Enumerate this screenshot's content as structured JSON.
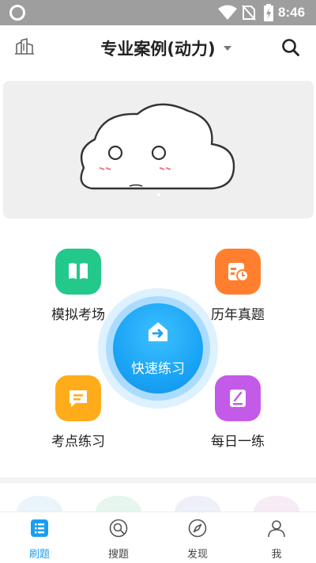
{
  "status_bar": {
    "time": "8:46"
  },
  "header": {
    "title": "专业案例(动力)"
  },
  "grid": {
    "mock_exam": "模拟考场",
    "past_papers": "历年真题",
    "quick_practice": "快速练习",
    "key_points": "考点练习",
    "daily": "每日一练"
  },
  "bottom_nav": {
    "items": [
      {
        "label": "刷题",
        "active": true
      },
      {
        "label": "搜题",
        "active": false
      },
      {
        "label": "发现",
        "active": false
      },
      {
        "label": "我",
        "active": false
      }
    ]
  },
  "colors": {
    "accent": "#1a9ff0",
    "mock_exam": "#22c98a",
    "past_papers": "#ff7f2e",
    "key_points": "#ffac1a",
    "daily": "#c45ae8"
  },
  "icons": {
    "status": [
      "status-ring-icon",
      "wifi-icon",
      "no-sim-icon",
      "battery-icon"
    ],
    "header": [
      "buildings-icon",
      "dropdown-caret-icon",
      "search-icon"
    ],
    "grid": [
      "book-icon",
      "calendar-clock-icon",
      "house-arrow-icon",
      "message-icon",
      "edit-note-icon"
    ],
    "nav": [
      "list-icon",
      "search-circle-icon",
      "compass-icon",
      "user-icon"
    ]
  }
}
